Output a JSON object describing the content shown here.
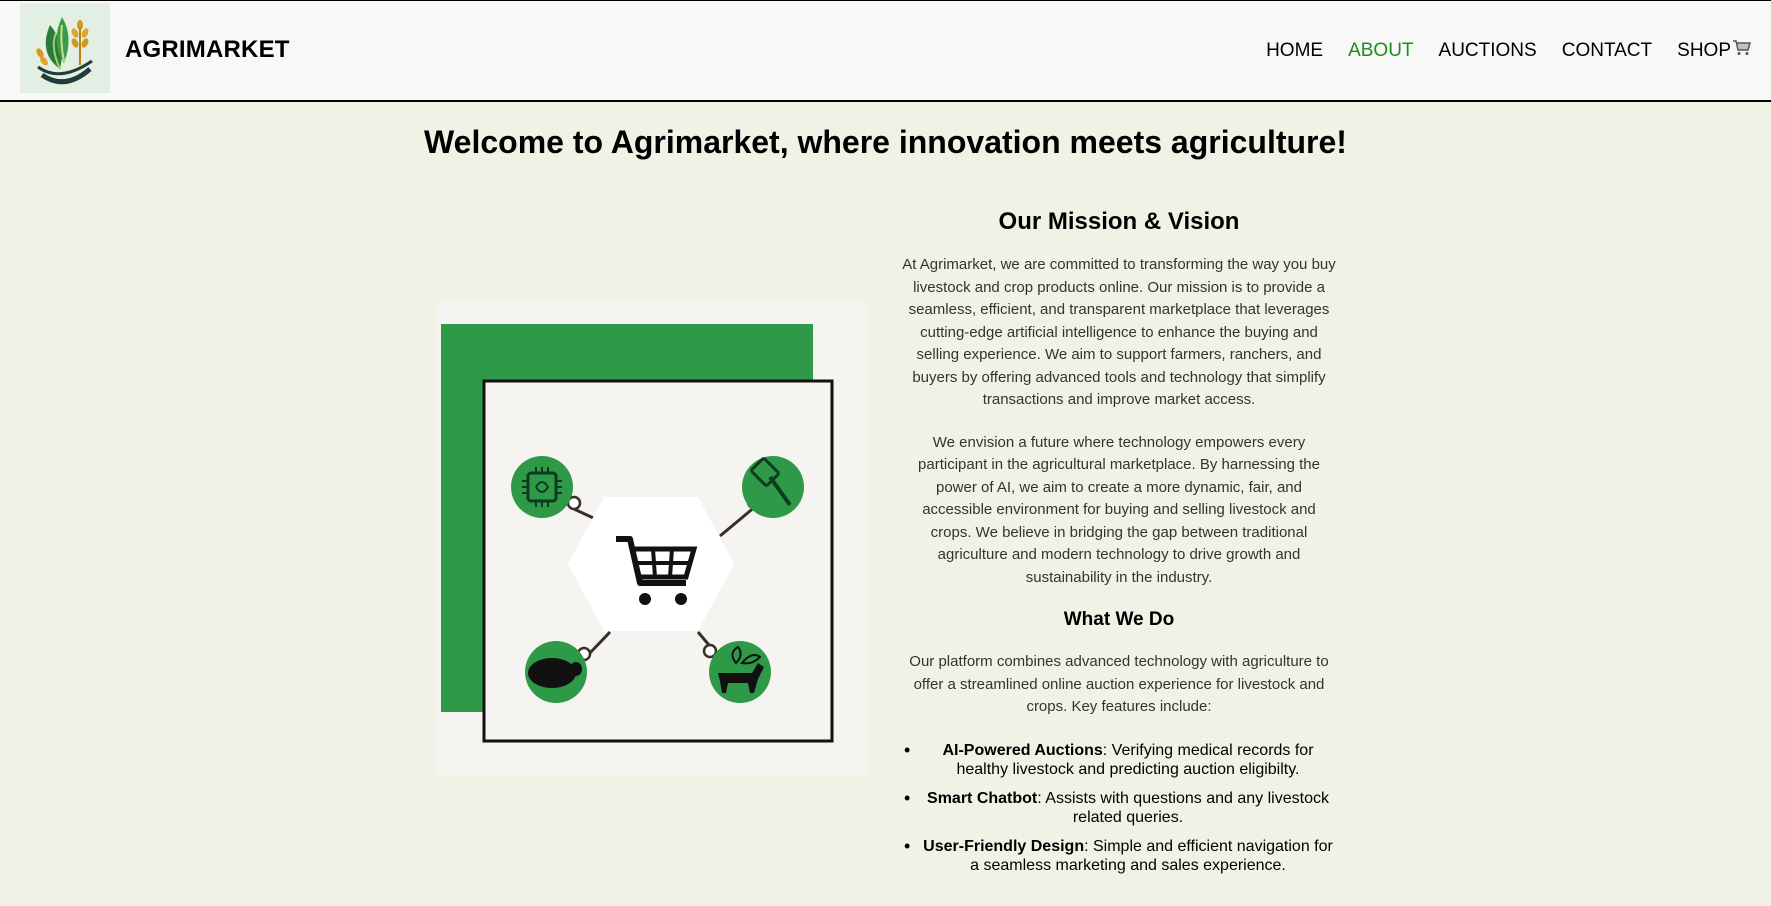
{
  "brand": {
    "name": "AGRIMARKET",
    "logo_icon": "wheat-leaf-logo-icon"
  },
  "nav": {
    "items": [
      {
        "label": "HOME",
        "active": false
      },
      {
        "label": "ABOUT",
        "active": true
      },
      {
        "label": "AUCTIONS",
        "active": false
      },
      {
        "label": "CONTACT",
        "active": false
      }
    ],
    "shop_label": "SHOP",
    "shop_icon": "shopping-cart-icon",
    "active_color": "#1e8c1e"
  },
  "hero": {
    "title": "Welcome to Agrimarket, where innovation meets agriculture!"
  },
  "illustration": {
    "icons": [
      "chip-icon",
      "auction-hammer-icon",
      "sheep-icon",
      "cow-plant-icon",
      "shopping-cart-icon"
    ],
    "accent_color": "#2e9947"
  },
  "mission": {
    "heading": "Our Mission & Vision",
    "paragraph1": "At Agrimarket, we are committed to transforming the way you buy livestock and crop products online. Our mission is to provide a seamless, efficient, and transparent marketplace that leverages cutting-edge artificial intelligence to enhance the buying and selling experience. We aim to support farmers, ranchers, and buyers by offering advanced tools and technology that simplify transactions and improve market access.",
    "paragraph2": "We envision a future where technology empowers every participant in the agricultural marketplace. By harnessing the power of AI, we aim to create a more dynamic, fair, and accessible environment for buying and selling livestock and crops. We believe in bridging the gap between traditional agriculture and modern technology to drive growth and sustainability in the industry."
  },
  "what_we_do": {
    "heading": "What We Do",
    "intro": "Our platform combines advanced technology with agriculture to offer a streamlined online auction experience for livestock and crops. Key features include:",
    "features": [
      {
        "title": "AI-Powered Auctions",
        "desc": ": Verifying medical records for healthy livestock and predicting auction eligibilty."
      },
      {
        "title": "Smart Chatbot",
        "desc": ": Assists with questions and any livestock related queries."
      },
      {
        "title": "User-Friendly Design",
        "desc": ": Simple and efficient navigation for a seamless marketing and sales experience."
      }
    ]
  },
  "colors": {
    "background": "#f2f1e6",
    "header": "#f8f8f8",
    "green": "#2e9947"
  }
}
